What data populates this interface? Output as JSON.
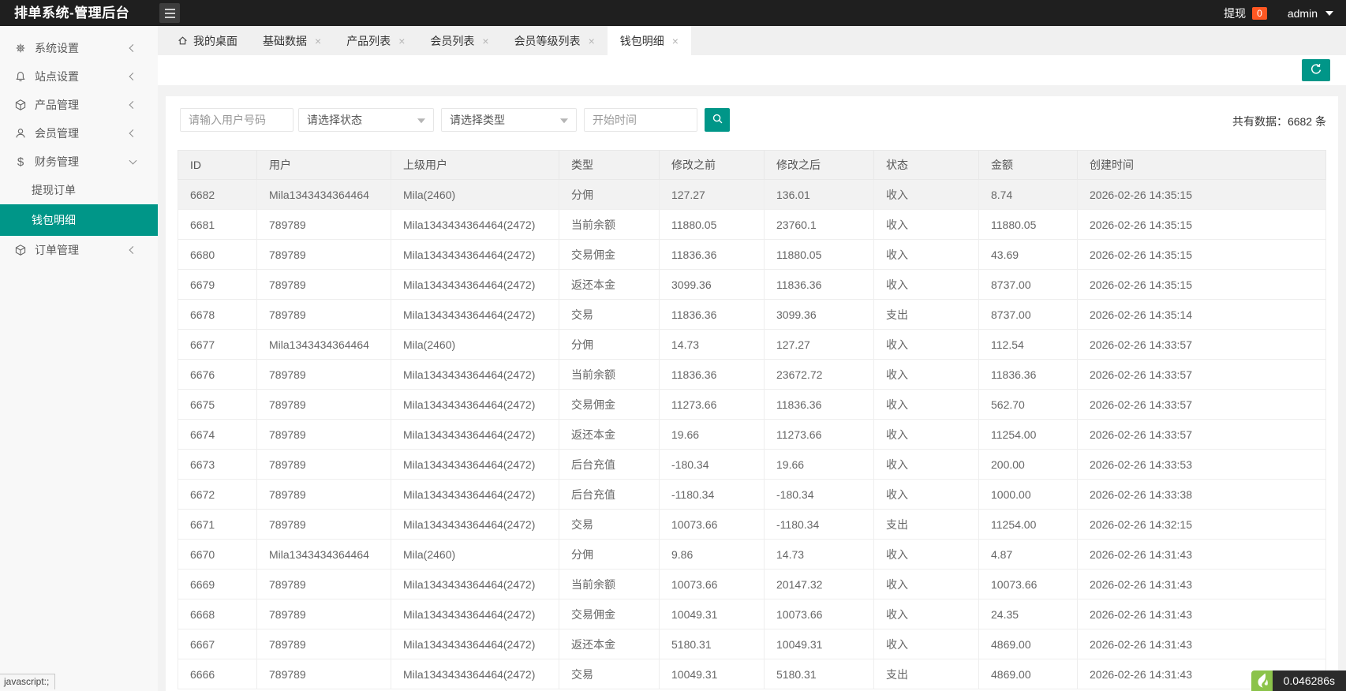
{
  "app": {
    "title": "排单系统-管理后台",
    "withdraw_label": "提现",
    "withdraw_badge": "0",
    "user": "admin",
    "accent_color": "#009688",
    "badge_color": "#ff5722",
    "topbar_color": "#1f1f1f"
  },
  "sidebar": {
    "items": [
      {
        "label": "系统设置",
        "icon": "gear-icon",
        "type": "parent",
        "chevron": "collapsed",
        "active": false
      },
      {
        "label": "站点设置",
        "icon": "bell-icon",
        "type": "parent",
        "chevron": "collapsed",
        "active": false
      },
      {
        "label": "产品管理",
        "icon": "cube-icon",
        "type": "parent",
        "chevron": "collapsed",
        "active": false
      },
      {
        "label": "会员管理",
        "icon": "user-icon",
        "type": "parent",
        "chevron": "collapsed",
        "active": false
      },
      {
        "label": "财务管理",
        "icon": "dollar-icon",
        "type": "parent",
        "chevron": "expanded",
        "active": false
      },
      {
        "label": "提现订单",
        "icon": "",
        "type": "child",
        "chevron": "",
        "active": false
      },
      {
        "label": "钱包明细",
        "icon": "",
        "type": "child",
        "chevron": "",
        "active": true
      },
      {
        "label": "订单管理",
        "icon": "cube-icon",
        "type": "parent",
        "chevron": "collapsed",
        "active": false
      }
    ]
  },
  "tabs": [
    {
      "label": "我的桌面",
      "icon": "home-icon",
      "closable": false,
      "active": false
    },
    {
      "label": "基础数据",
      "icon": "",
      "closable": true,
      "active": false
    },
    {
      "label": "产品列表",
      "icon": "",
      "closable": true,
      "active": false
    },
    {
      "label": "会员列表",
      "icon": "",
      "closable": true,
      "active": false
    },
    {
      "label": "会员等级列表",
      "icon": "",
      "closable": true,
      "active": false
    },
    {
      "label": "钱包明细",
      "icon": "",
      "closable": true,
      "active": true
    }
  ],
  "toolbar": {
    "refresh_icon": "refresh-icon"
  },
  "filters": {
    "user_placeholder": "请输入用户号码",
    "status_placeholder": "请选择状态",
    "type_placeholder": "请选择类型",
    "time_placeholder": "开始时间",
    "search_icon": "magnifier-icon"
  },
  "summary": {
    "text": "共有数据：6682 条"
  },
  "table": {
    "columns": [
      "ID",
      "用户",
      "上级用户",
      "类型",
      "修改之前",
      "修改之后",
      "状态",
      "金额",
      "创建时间"
    ],
    "rows": [
      [
        "6682",
        "Mila1343434364464",
        "Mila(2460)",
        "分佣",
        "127.27",
        "136.01",
        "收入",
        "8.74",
        "2026-02-26 14:35:15"
      ],
      [
        "6681",
        "789789",
        "Mila1343434364464(2472)",
        "当前余额",
        "11880.05",
        "23760.1",
        "收入",
        "11880.05",
        "2026-02-26 14:35:15"
      ],
      [
        "6680",
        "789789",
        "Mila1343434364464(2472)",
        "交易佣金",
        "11836.36",
        "11880.05",
        "收入",
        "43.69",
        "2026-02-26 14:35:15"
      ],
      [
        "6679",
        "789789",
        "Mila1343434364464(2472)",
        "返还本金",
        "3099.36",
        "11836.36",
        "收入",
        "8737.00",
        "2026-02-26 14:35:15"
      ],
      [
        "6678",
        "789789",
        "Mila1343434364464(2472)",
        "交易",
        "11836.36",
        "3099.36",
        "支出",
        "8737.00",
        "2026-02-26 14:35:14"
      ],
      [
        "6677",
        "Mila1343434364464",
        "Mila(2460)",
        "分佣",
        "14.73",
        "127.27",
        "收入",
        "112.54",
        "2026-02-26 14:33:57"
      ],
      [
        "6676",
        "789789",
        "Mila1343434364464(2472)",
        "当前余额",
        "11836.36",
        "23672.72",
        "收入",
        "11836.36",
        "2026-02-26 14:33:57"
      ],
      [
        "6675",
        "789789",
        "Mila1343434364464(2472)",
        "交易佣金",
        "11273.66",
        "11836.36",
        "收入",
        "562.70",
        "2026-02-26 14:33:57"
      ],
      [
        "6674",
        "789789",
        "Mila1343434364464(2472)",
        "返还本金",
        "19.66",
        "11273.66",
        "收入",
        "11254.00",
        "2026-02-26 14:33:57"
      ],
      [
        "6673",
        "789789",
        "Mila1343434364464(2472)",
        "后台充值",
        "-180.34",
        "19.66",
        "收入",
        "200.00",
        "2026-02-26 14:33:53"
      ],
      [
        "6672",
        "789789",
        "Mila1343434364464(2472)",
        "后台充值",
        "-1180.34",
        "-180.34",
        "收入",
        "1000.00",
        "2026-02-26 14:33:38"
      ],
      [
        "6671",
        "789789",
        "Mila1343434364464(2472)",
        "交易",
        "10073.66",
        "-1180.34",
        "支出",
        "11254.00",
        "2026-02-26 14:32:15"
      ],
      [
        "6670",
        "Mila1343434364464",
        "Mila(2460)",
        "分佣",
        "9.86",
        "14.73",
        "收入",
        "4.87",
        "2026-02-26 14:31:43"
      ],
      [
        "6669",
        "789789",
        "Mila1343434364464(2472)",
        "当前余额",
        "10073.66",
        "20147.32",
        "收入",
        "10073.66",
        "2026-02-26 14:31:43"
      ],
      [
        "6668",
        "789789",
        "Mila1343434364464(2472)",
        "交易佣金",
        "10049.31",
        "10073.66",
        "收入",
        "24.35",
        "2026-02-26 14:31:43"
      ],
      [
        "6667",
        "789789",
        "Mila1343434364464(2472)",
        "返还本金",
        "5180.31",
        "10049.31",
        "收入",
        "4869.00",
        "2026-02-26 14:31:43"
      ],
      [
        "6666",
        "789789",
        "Mila1343434364464(2472)",
        "交易",
        "10049.31",
        "5180.31",
        "支出",
        "4869.00",
        "2026-02-26 14:31:43"
      ]
    ]
  },
  "statusbar": {
    "left_text": "javascript:;",
    "right_text": "0.046286s",
    "trace_logo": "thinkphp-flame-icon",
    "trace_green": "#8bc34a"
  }
}
